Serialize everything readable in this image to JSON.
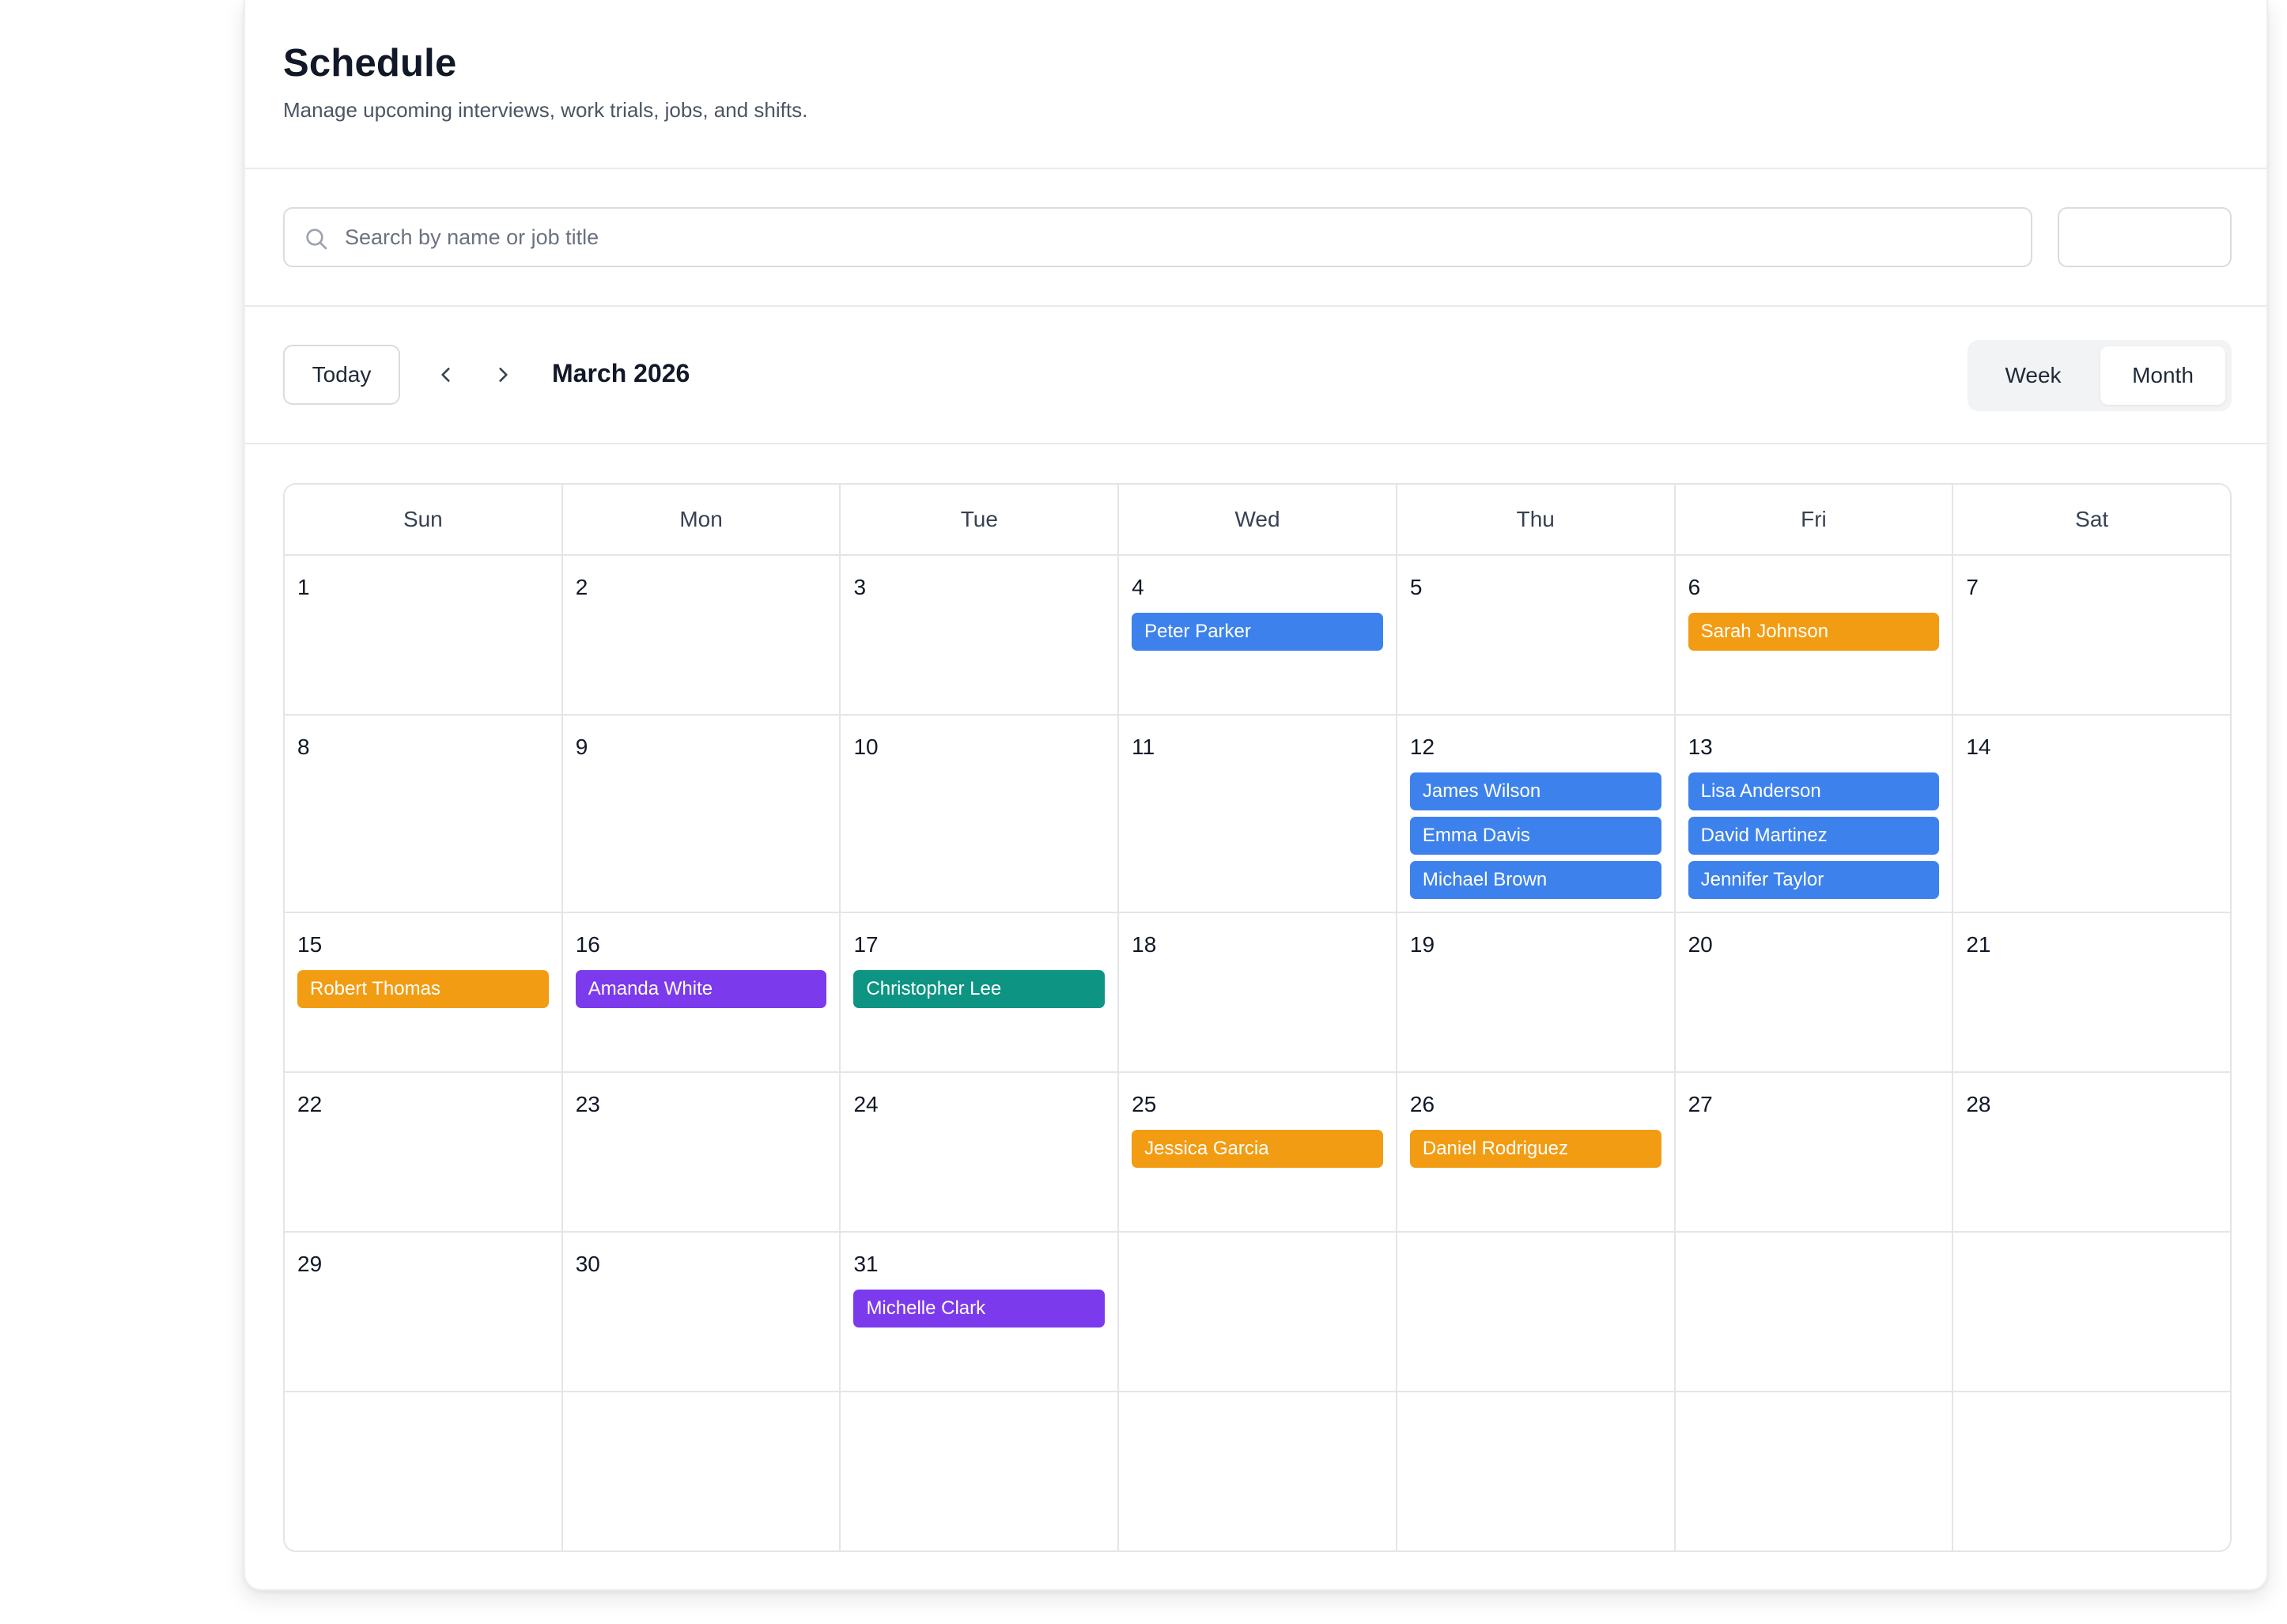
{
  "header": {
    "title": "Schedule",
    "subtitle": "Manage upcoming interviews, work trials, jobs, and shifts."
  },
  "search": {
    "placeholder": "Search by name or job title",
    "value": ""
  },
  "toolbar": {
    "today_label": "Today",
    "month_label": "March 2026",
    "views": [
      "Week",
      "Month"
    ],
    "active_view": "Month"
  },
  "colors": {
    "blue": "#3d82ec",
    "orange": "#f29c13",
    "purple": "#7c3aed",
    "teal": "#0e9483"
  },
  "calendar": {
    "days_of_week": [
      "Sun",
      "Mon",
      "Tue",
      "Wed",
      "Thu",
      "Fri",
      "Sat"
    ],
    "weeks": [
      [
        {
          "day": "1",
          "events": []
        },
        {
          "day": "2",
          "events": []
        },
        {
          "day": "3",
          "events": []
        },
        {
          "day": "4",
          "events": [
            {
              "name": "Peter Parker",
              "color": "#3d82ec"
            }
          ]
        },
        {
          "day": "5",
          "events": []
        },
        {
          "day": "6",
          "events": [
            {
              "name": "Sarah Johnson",
              "color": "#f29c13"
            }
          ]
        },
        {
          "day": "7",
          "events": []
        }
      ],
      [
        {
          "day": "8",
          "events": []
        },
        {
          "day": "9",
          "events": []
        },
        {
          "day": "10",
          "events": []
        },
        {
          "day": "11",
          "events": []
        },
        {
          "day": "12",
          "events": [
            {
              "name": "James Wilson",
              "color": "#3d82ec"
            },
            {
              "name": "Emma Davis",
              "color": "#3d82ec"
            },
            {
              "name": "Michael Brown",
              "color": "#3d82ec"
            }
          ]
        },
        {
          "day": "13",
          "events": [
            {
              "name": "Lisa Anderson",
              "color": "#3d82ec"
            },
            {
              "name": "David Martinez",
              "color": "#3d82ec"
            },
            {
              "name": "Jennifer Taylor",
              "color": "#3d82ec"
            }
          ]
        },
        {
          "day": "14",
          "events": []
        }
      ],
      [
        {
          "day": "15",
          "events": [
            {
              "name": "Robert Thomas",
              "color": "#f29c13"
            }
          ]
        },
        {
          "day": "16",
          "events": [
            {
              "name": "Amanda White",
              "color": "#7c3aed"
            }
          ]
        },
        {
          "day": "17",
          "events": [
            {
              "name": "Christopher Lee",
              "color": "#0e9483"
            }
          ]
        },
        {
          "day": "18",
          "events": []
        },
        {
          "day": "19",
          "events": []
        },
        {
          "day": "20",
          "events": []
        },
        {
          "day": "21",
          "events": []
        }
      ],
      [
        {
          "day": "22",
          "events": []
        },
        {
          "day": "23",
          "events": []
        },
        {
          "day": "24",
          "events": []
        },
        {
          "day": "25",
          "events": [
            {
              "name": "Jessica Garcia",
              "color": "#f29c13"
            }
          ]
        },
        {
          "day": "26",
          "events": [
            {
              "name": "Daniel Rodriguez",
              "color": "#f29c13"
            }
          ]
        },
        {
          "day": "27",
          "events": []
        },
        {
          "day": "28",
          "events": []
        }
      ],
      [
        {
          "day": "29",
          "events": []
        },
        {
          "day": "30",
          "events": []
        },
        {
          "day": "31",
          "events": [
            {
              "name": "Michelle Clark",
              "color": "#7c3aed"
            }
          ]
        },
        {
          "day": "",
          "events": []
        },
        {
          "day": "",
          "events": []
        },
        {
          "day": "",
          "events": []
        },
        {
          "day": "",
          "events": []
        }
      ],
      [
        {
          "day": "",
          "events": []
        },
        {
          "day": "",
          "events": []
        },
        {
          "day": "",
          "events": []
        },
        {
          "day": "",
          "events": []
        },
        {
          "day": "",
          "events": []
        },
        {
          "day": "",
          "events": []
        },
        {
          "day": "",
          "events": []
        }
      ]
    ]
  }
}
